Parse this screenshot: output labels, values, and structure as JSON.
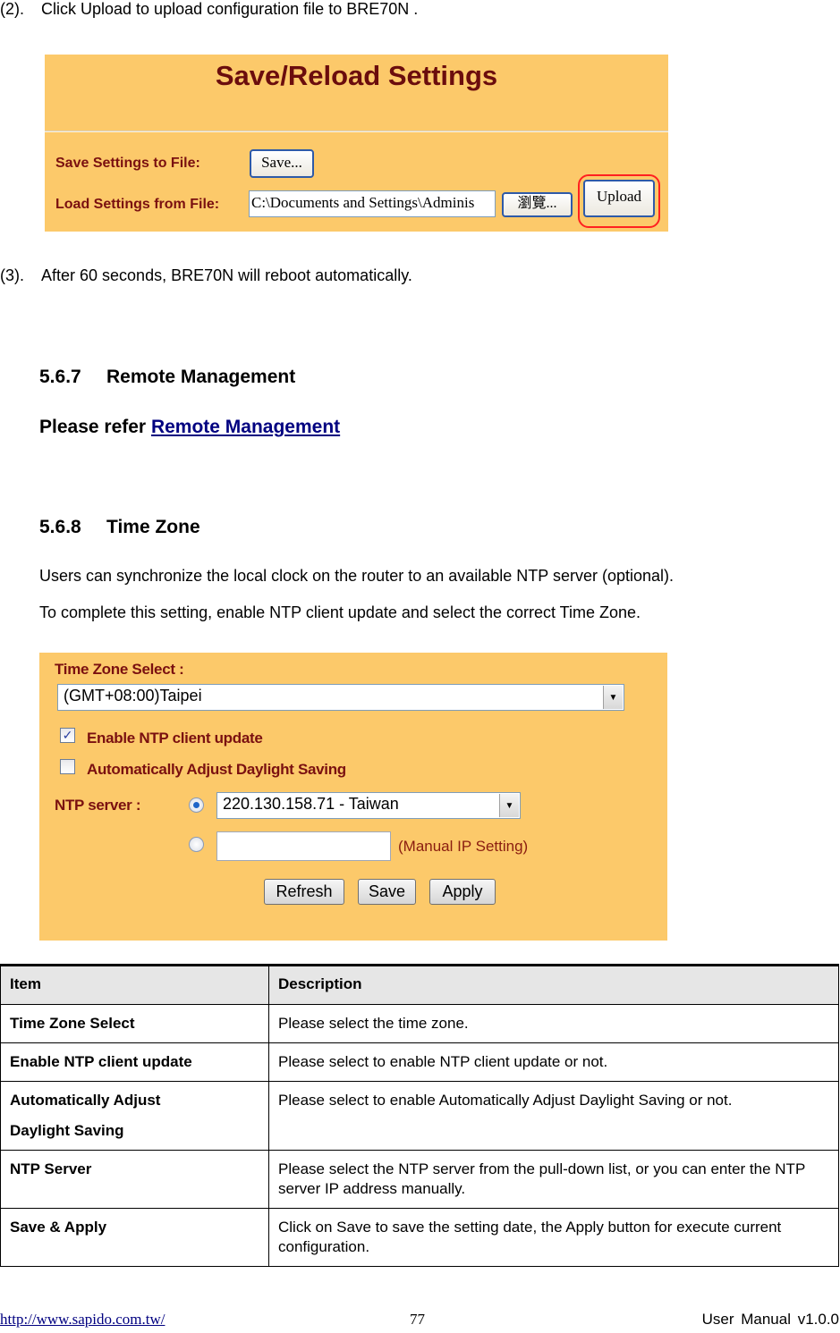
{
  "steps": [
    {
      "num": "(2).",
      "text": "Click Upload to upload configuration file to BRE70N ."
    },
    {
      "num": "(3).",
      "text": "After 60 seconds, BRE70N will reboot automatically."
    }
  ],
  "save_reload": {
    "title": "Save/Reload Settings",
    "save_label": "Save Settings to File:",
    "save_button": "Save...",
    "load_label": "Load Settings from File:",
    "file_path": "C:\\Documents and Settings\\Adminis",
    "browse_button": "瀏覽...",
    "upload_button": "Upload",
    "highlight_color": "#ff2020",
    "bg_color": "#fcc96a"
  },
  "section_567": {
    "number": "5.6.7",
    "title": "Remote Management",
    "refer_prefix": "Please refer",
    "refer_link": "Remote Management"
  },
  "section_568": {
    "number": "5.6.8",
    "title": "Time Zone",
    "para1": "Users can synchronize the local clock on the router to an available NTP server (optional).",
    "para2": "To complete this setting, enable NTP client update and select the correct Time Zone."
  },
  "time_zone_ui": {
    "tz_label": "Time Zone Select :",
    "tz_value": "(GMT+08:00)Taipei",
    "enable_ntp_label": "Enable NTP client update",
    "enable_ntp_checked": true,
    "dst_label": "Automatically Adjust Daylight Saving",
    "dst_checked": false,
    "ntp_label": "NTP server :",
    "ntp_value": "220.130.158.71 - Taiwan",
    "ntp_mode": "list",
    "manual_ip_value": "",
    "manual_hint": "(Manual IP Setting)",
    "buttons": {
      "refresh": "Refresh",
      "save": "Save",
      "apply": "Apply"
    }
  },
  "table": {
    "headers": {
      "item": "Item",
      "description": "Description"
    },
    "rows": [
      {
        "item": "Time Zone Select",
        "description": "Please select the time zone."
      },
      {
        "item": "Enable NTP client update",
        "description": "Please select to enable NTP client update or not."
      },
      {
        "item": "Automatically Adjust Daylight Saving",
        "description": "Please select to enable Automatically Adjust Daylight Saving or not."
      },
      {
        "item": "NTP Server",
        "description": "Please select the NTP server from the pull-down list, or you can enter the NTP server IP address manually."
      },
      {
        "item": "Save & Apply",
        "description": "Click on Save to save the setting date, the Apply button for execute current configuration."
      }
    ]
  },
  "footer": {
    "url": "http://www.sapido.com.tw/",
    "page": "77",
    "version": "User Manual v1.0.0"
  }
}
